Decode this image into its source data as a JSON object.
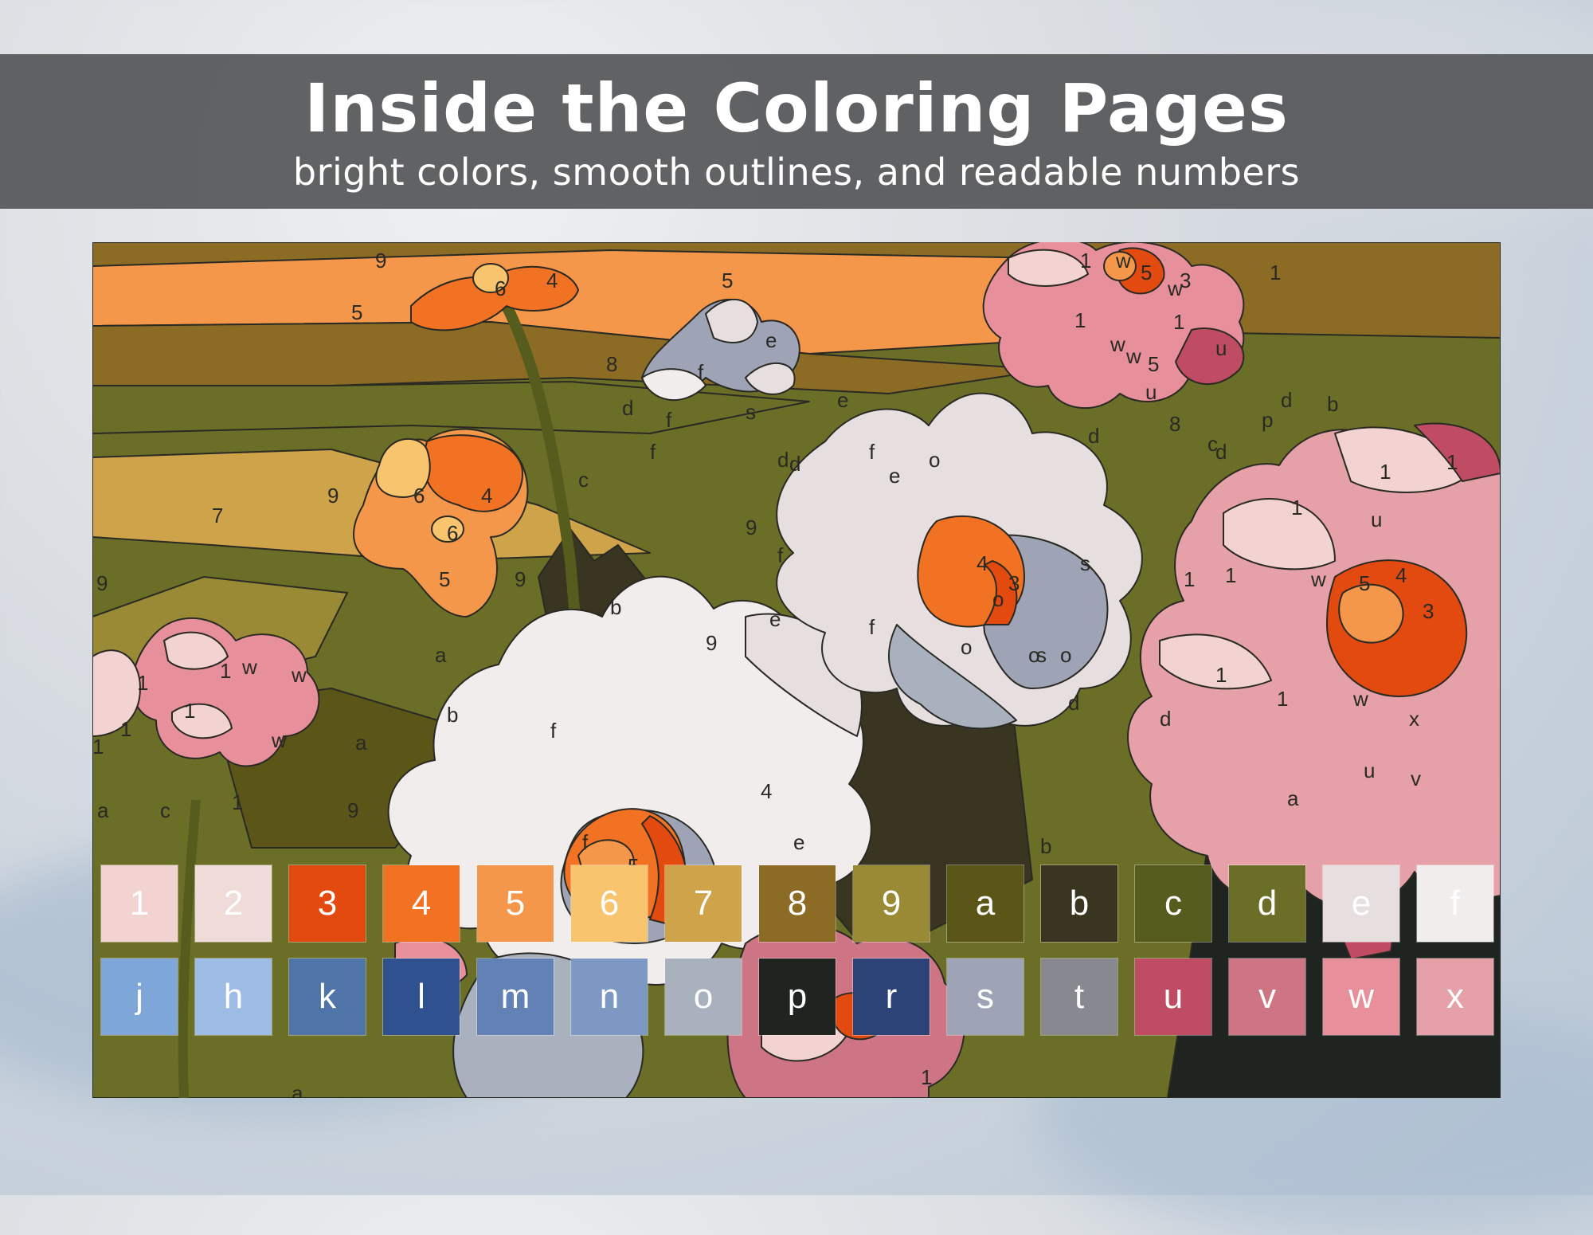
{
  "header": {
    "title": "Inside the Coloring Pages",
    "subtitle": "bright colors, smooth outlines, and readable numbers"
  },
  "palette": {
    "row1": [
      {
        "label": "1",
        "color": "#f3d2d2"
      },
      {
        "label": "2",
        "color": "#efdcd8"
      },
      {
        "label": "3",
        "color": "#e24a10"
      },
      {
        "label": "4",
        "color": "#f07222"
      },
      {
        "label": "5",
        "color": "#f4974a"
      },
      {
        "label": "6",
        "color": "#f8c46e"
      },
      {
        "label": "7",
        "color": "#cfa34a"
      },
      {
        "label": "8",
        "color": "#8c6c25"
      },
      {
        "label": "9",
        "color": "#9a8a35"
      },
      {
        "label": "a",
        "color": "#5c5518"
      },
      {
        "label": "b",
        "color": "#3a3520"
      },
      {
        "label": "c",
        "color": "#565b1e"
      },
      {
        "label": "d",
        "color": "#6b6e26"
      },
      {
        "label": "e",
        "color": "#e6dedf"
      },
      {
        "label": "f",
        "color": "#f1eded"
      }
    ],
    "row2": [
      {
        "label": "j",
        "color": "#7ea6d8"
      },
      {
        "label": "h",
        "color": "#9dbbe3"
      },
      {
        "label": "k",
        "color": "#4e74a8"
      },
      {
        "label": "l",
        "color": "#2f5190"
      },
      {
        "label": "m",
        "color": "#6281b4"
      },
      {
        "label": "n",
        "color": "#7e98c4"
      },
      {
        "label": "o",
        "color": "#a9b1bf"
      },
      {
        "label": "p",
        "color": "#1f2420"
      },
      {
        "label": "r",
        "color": "#2c4378"
      },
      {
        "label": "s",
        "color": "#9ea4b6"
      },
      {
        "label": "t",
        "color": "#888890"
      },
      {
        "label": "u",
        "color": "#c04c64"
      },
      {
        "label": "v",
        "color": "#cd7585"
      },
      {
        "label": "w",
        "color": "#e78f9b"
      },
      {
        "label": "x",
        "color": "#e5a0a8"
      }
    ]
  },
  "artwork": {
    "labels": [
      "9",
      "5",
      "4",
      "6",
      "5",
      "8",
      "e",
      "f",
      "s",
      "e",
      "d",
      "f",
      "f",
      "d",
      "c",
      "d",
      "6",
      "4",
      "6",
      "5",
      "9",
      "9",
      "7",
      "9",
      "f",
      "e",
      "f",
      "o",
      "4",
      "3",
      "e",
      "f",
      "s",
      "o",
      "o",
      "s",
      "o",
      "f",
      "9",
      "b",
      "a",
      "b",
      "a",
      "1",
      "w",
      "w",
      "1",
      "1",
      "1",
      "1",
      "w",
      "1",
      "a",
      "c",
      "9",
      "9",
      "f",
      "5",
      "4",
      "e",
      "o",
      "d",
      "d",
      "a",
      "b",
      "1",
      "w",
      "5",
      "3",
      "1",
      "w",
      "1",
      "w",
      "w",
      "1",
      "u",
      "5",
      "u",
      "d",
      "8",
      "c",
      "d",
      "p",
      "d",
      "b",
      "1",
      "u",
      "1",
      "1",
      "1",
      "1",
      "w",
      "5",
      "4",
      "3",
      "1",
      "1",
      "w",
      "x",
      "u",
      "v",
      "a",
      "e",
      "1",
      "a"
    ]
  }
}
